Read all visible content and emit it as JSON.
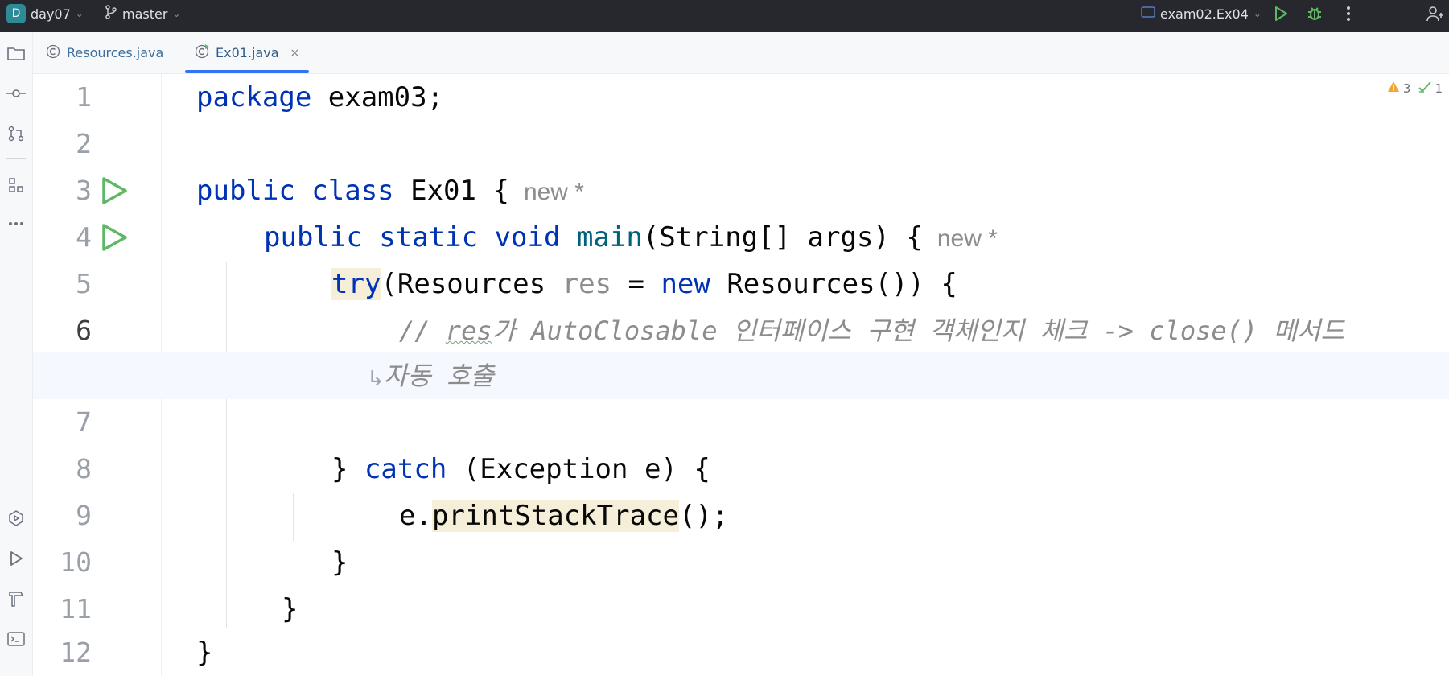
{
  "titlebar": {
    "project_badge": "D",
    "project_name": "day07",
    "branch_name": "master",
    "run_config": "exam02.Ex04",
    "icons": [
      "branch-icon",
      "run-config-icon",
      "run-icon",
      "debug-icon",
      "more-icon",
      "add-user-icon"
    ],
    "colors": {
      "bg": "#27282e",
      "run": "#5fb865",
      "debug": "#5fb865"
    }
  },
  "leftbar": {
    "icons": [
      "folder-icon",
      "commit-icon",
      "pull-request-icon",
      "structure-icon",
      "more-tools-icon",
      "services-icon",
      "run-tool-icon",
      "build-icon",
      "terminal-icon"
    ]
  },
  "tabs": [
    {
      "label": "Resources.java",
      "active": false,
      "icon": "class-icon"
    },
    {
      "label": "Ex01.java",
      "active": true,
      "icon": "class-runnable-icon",
      "close": "×"
    }
  ],
  "inspections": {
    "warnings": "3",
    "checks": "1"
  },
  "editor": {
    "lines": [
      {
        "num": "1"
      },
      {
        "num": "2"
      },
      {
        "num": "3",
        "run": true
      },
      {
        "num": "4",
        "run": true
      },
      {
        "num": "5"
      },
      {
        "num": "6",
        "current": true
      },
      {
        "num": "7"
      },
      {
        "num": "8"
      },
      {
        "num": "9"
      },
      {
        "num": "10"
      },
      {
        "num": "11"
      },
      {
        "num": "12"
      }
    ],
    "code": {
      "l1_kw": "package",
      "l1_rest": " exam03;",
      "l3_kw": "public class",
      "l3_rest": " Ex01 {",
      "l3_hint": "new *",
      "l4_kw": "public static void",
      "l4_fn": "main",
      "l4_rest": "(String[] args) {",
      "l4_hint": "new *",
      "l5_kw": "try",
      "l5_a": "(Resources ",
      "l5_var": "res",
      "l5_b": " = ",
      "l5_new": "new",
      "l5_c": " Resources()) {",
      "l6_prefix": "// ",
      "l6_res": "res",
      "l6_text": "가 AutoClosable 인터페이스 구현 객체인지 체크 -> close() 메서드",
      "l6_wrap": "자동 호출",
      "l8_a": "} ",
      "l8_kw": "catch",
      "l8_b": " (Exception e) {",
      "l9_a": "e.",
      "l9_call": "printStackTrace",
      "l9_b": "();",
      "l10": "}",
      "l11": "}",
      "l12": "}"
    }
  }
}
